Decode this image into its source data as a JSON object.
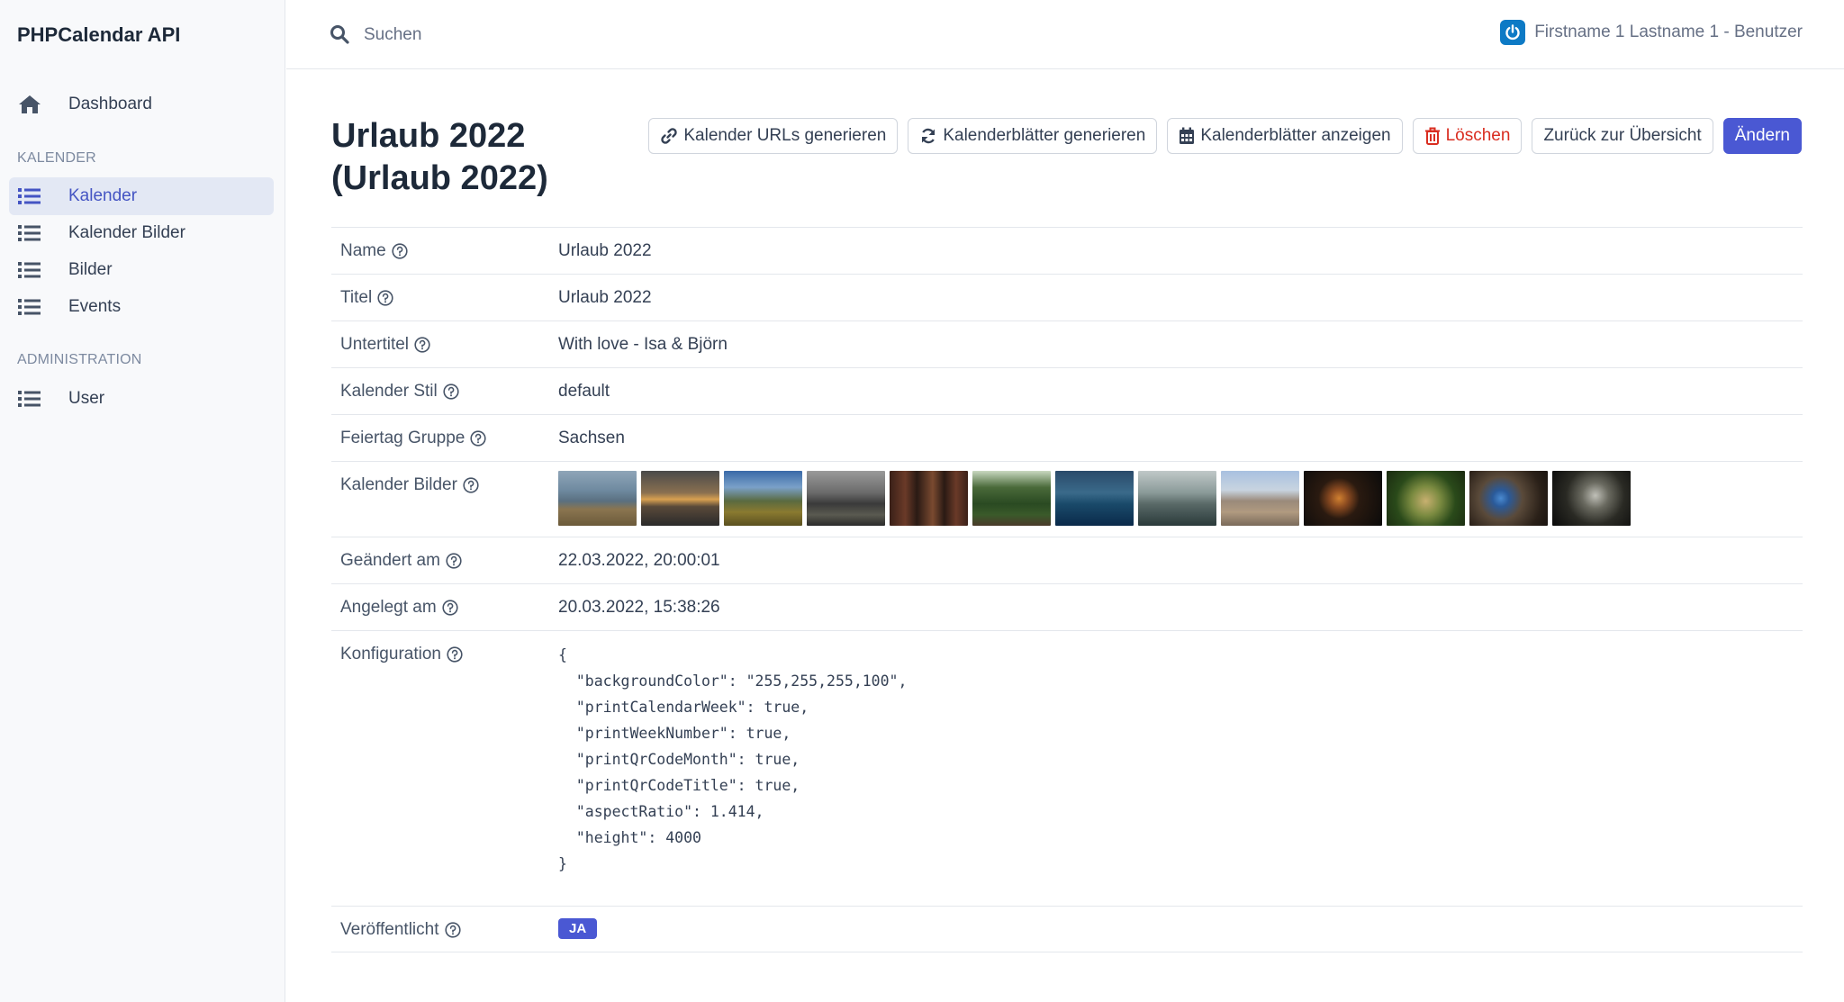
{
  "sidebar": {
    "brand": "PHPCalendar API",
    "dashboard": "Dashboard",
    "section_kalender": "KALENDER",
    "items": [
      "Kalender",
      "Kalender Bilder",
      "Bilder",
      "Events"
    ],
    "section_admin": "ADMINISTRATION",
    "admin_items": [
      "User"
    ]
  },
  "topbar": {
    "search_placeholder": "Suchen",
    "user": "Firstname 1 Lastname 1 - Benutzer"
  },
  "page": {
    "title_line1": "Urlaub 2022",
    "title_line2": "(Urlaub 2022)"
  },
  "actions": {
    "urls": "Kalender URLs generieren",
    "generate": "Kalenderblätter generieren",
    "show": "Kalenderblätter anzeigen",
    "delete": "Löschen",
    "back": "Zurück zur Übersicht",
    "edit": "Ändern"
  },
  "fields": {
    "name": {
      "label": "Name",
      "value": "Urlaub 2022"
    },
    "title": {
      "label": "Titel",
      "value": "Urlaub 2022"
    },
    "subtitle": {
      "label": "Untertitel",
      "value": "With love - Isa & Björn"
    },
    "style": {
      "label": "Kalender Stil",
      "value": "default"
    },
    "holiday": {
      "label": "Feiertag Gruppe",
      "value": "Sachsen"
    },
    "images": {
      "label": "Kalender Bilder"
    },
    "changed": {
      "label": "Geändert am",
      "value": "22.03.2022, 20:00:01"
    },
    "created": {
      "label": "Angelegt am",
      "value": "20.03.2022, 15:38:26"
    },
    "config": {
      "label": "Konfiguration",
      "value": "{\n  \"backgroundColor\": \"255,255,255,100\",\n  \"printCalendarWeek\": true,\n  \"printWeekNumber\": true,\n  \"printQrCodeMonth\": true,\n  \"printQrCodeTitle\": true,\n  \"aspectRatio\": 1.414,\n  \"height\": 4000\n}"
    },
    "published": {
      "label": "Veröffentlicht",
      "value": "JA"
    }
  },
  "thumbnails": [
    {
      "name": "coast"
    },
    {
      "name": "sunset-sea"
    },
    {
      "name": "mountain-valley"
    },
    {
      "name": "stormy-coast"
    },
    {
      "name": "vineyard-vats"
    },
    {
      "name": "forest"
    },
    {
      "name": "blue-sea"
    },
    {
      "name": "boat"
    },
    {
      "name": "town-view"
    },
    {
      "name": "bee"
    },
    {
      "name": "hedgehog-plant"
    },
    {
      "name": "blue-circle"
    },
    {
      "name": "bird"
    }
  ],
  "colors": {
    "primary": "#4a58d3",
    "danger": "#d92d20",
    "sidebar_bg": "#f8f9fb",
    "active_bg": "#e3e8f4",
    "power": "#0d7ac5"
  }
}
